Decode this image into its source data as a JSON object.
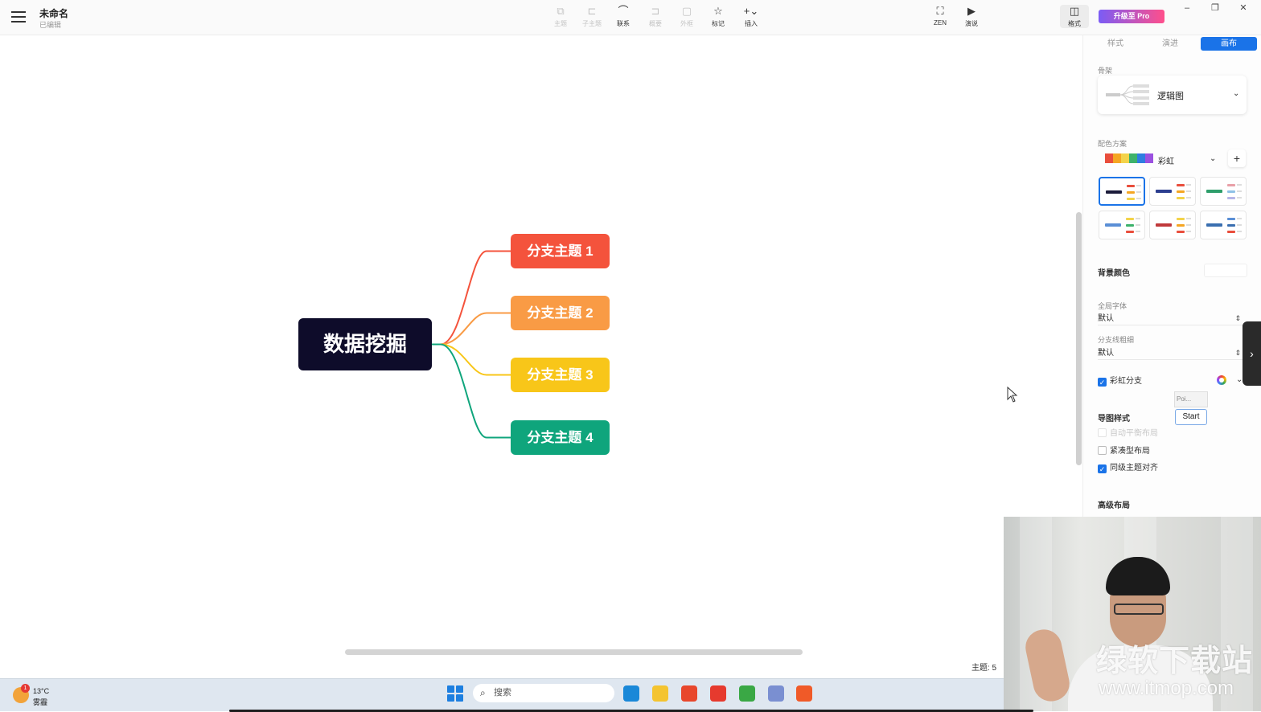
{
  "window": {
    "doc_title": "未命名",
    "doc_status": "已编辑",
    "upgrade_label": "升级至 Pro",
    "controls": {
      "minimize": "–",
      "maximize": "❐",
      "close": "✕"
    }
  },
  "toolbar": {
    "tools": [
      {
        "id": "topic",
        "label": "主题",
        "icon": "topic-icon",
        "glyph": "⧉",
        "disabled": true
      },
      {
        "id": "subtopic",
        "label": "子主题",
        "icon": "subtopic-icon",
        "glyph": "⊏",
        "disabled": true
      },
      {
        "id": "relation",
        "label": "联系",
        "icon": "relation-curve-icon",
        "glyph": "⌒",
        "disabled": false
      },
      {
        "id": "summary",
        "label": "概要",
        "icon": "summary-bracket-icon",
        "glyph": "⊐",
        "disabled": true
      },
      {
        "id": "boundary",
        "label": "外框",
        "icon": "boundary-icon",
        "glyph": "▢",
        "disabled": true
      },
      {
        "id": "marker",
        "label": "标记",
        "icon": "star-icon",
        "glyph": "☆",
        "disabled": false
      },
      {
        "id": "insert",
        "label": "插入",
        "icon": "plus-icon",
        "glyph": "+⌄",
        "disabled": false
      }
    ],
    "right_tools": [
      {
        "id": "zen",
        "label": "ZEN",
        "icon": "fullscreen-icon",
        "glyph": "⛶"
      },
      {
        "id": "present",
        "label": "演说",
        "icon": "presentation-icon",
        "glyph": "▶"
      }
    ],
    "format": {
      "label": "格式",
      "icon": "format-panel-icon",
      "glyph": "◫"
    }
  },
  "mindmap": {
    "root": {
      "label": "数据挖掘",
      "color": "#0e0c2a"
    },
    "branches": [
      {
        "label": "分支主题 1",
        "color": "#f4533c"
      },
      {
        "label": "分支主题 2",
        "color": "#f99b45"
      },
      {
        "label": "分支主题 3",
        "color": "#f8c619"
      },
      {
        "label": "分支主题 4",
        "color": "#0fa57c"
      }
    ]
  },
  "status": {
    "topic_count": "主题: 5"
  },
  "panel": {
    "tabs": [
      {
        "label": "样式",
        "active": false
      },
      {
        "label": "演进",
        "active": false
      },
      {
        "label": "画布",
        "active": true
      }
    ],
    "structure": {
      "label": "骨架",
      "value": "逻辑图"
    },
    "color_scheme": {
      "label": "配色方案",
      "value": "彩虹",
      "swatches": [
        "#e94e3c",
        "#f5a623",
        "#f3d34a",
        "#3db26b",
        "#2f7de1",
        "#9b51e0"
      ]
    },
    "background": {
      "label": "背景颜色"
    },
    "global_font": {
      "label": "全局字体",
      "value": "默认"
    },
    "branch_width": {
      "label": "分支线粗细",
      "value": "默认"
    },
    "rainbow_branch": {
      "label": "彩虹分支",
      "checked": true
    },
    "map_style": {
      "label": "导图样式"
    },
    "auto_balance": {
      "label": "自动平衡布局",
      "checked": false
    },
    "compact_layout": {
      "label": "紧凑型布局",
      "checked": false
    },
    "align_siblings": {
      "label": "同级主题对齐",
      "checked": true
    },
    "advanced_layout": {
      "label": "高级布局"
    }
  },
  "popup": {
    "poi": "Poi...",
    "start": "Start"
  },
  "taskbar": {
    "weather_temp": "13°C",
    "weather_cond": "雾霾",
    "weather_badge": "1",
    "search_placeholder": "搜索",
    "apps": [
      {
        "name": "edge-icon",
        "color": "#1a88d8"
      },
      {
        "name": "file-explorer-icon",
        "color": "#f4c430"
      },
      {
        "name": "app-red-icon",
        "color": "#e8472c"
      },
      {
        "name": "wps-icon",
        "color": "#e63a2e"
      },
      {
        "name": "camtasia-icon",
        "color": "#3aa845"
      },
      {
        "name": "paint-icon",
        "color": "#7a8fd1"
      },
      {
        "name": "recorder-icon",
        "color": "#f05a28"
      }
    ]
  },
  "watermark": {
    "brand": "绿软下载站",
    "url": "www.itmop.com"
  }
}
